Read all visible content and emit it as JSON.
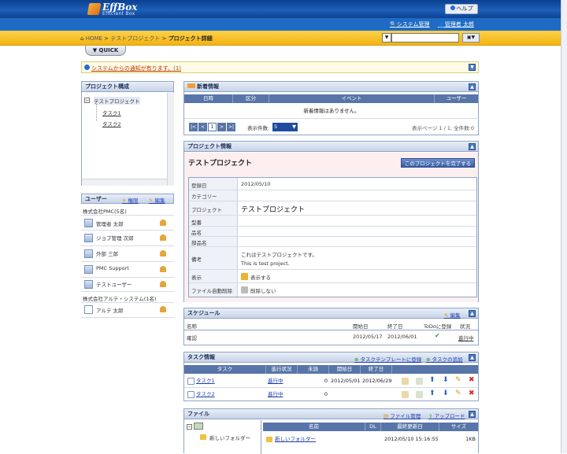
{
  "header": {
    "brand": "EffBox",
    "brand_sub": "Efficient Box",
    "help": "ヘルプ",
    "system_mgmt": "システム管理",
    "admin_user": "管理者 太郎"
  },
  "breadcrumb": {
    "home": "HOME",
    "sep": ">",
    "project": "テストプロジェクト",
    "current": "プロジェクト詳細"
  },
  "search": {
    "select_value": "▼",
    "button": "▣▼"
  },
  "quick": "▼ QUICK",
  "notice": "システムからの通知が有ります。(1)",
  "tree": {
    "title": "プロジェクト構成",
    "root": "テストプロジェクト",
    "children": [
      "タスク1",
      "タスク2"
    ]
  },
  "users": {
    "title": "ユーザー",
    "perm": "権限",
    "edit": "編集",
    "groups": [
      {
        "name": "株式会社PMC(5名)",
        "members": [
          "管理者 太郎",
          "ジョブ管理 次郎",
          "外部 三郎",
          "PMC Support",
          "テストユーザー"
        ]
      },
      {
        "name": "株式会社アルテ・システム(1名)",
        "members": [
          "アルテ 太郎"
        ]
      }
    ]
  },
  "news": {
    "title": "新着情報",
    "cols": [
      "日時",
      "区分",
      "イベント",
      "ユーザー"
    ],
    "empty": "新着情報はありません。",
    "pager": {
      "first": "|<",
      "prev": "<",
      "page": "1",
      "next": ">",
      "last": ">|",
      "count_label": "表示件数:",
      "count": "5",
      "summary": "表示ページ 1 / 1, 全件数:0"
    }
  },
  "project": {
    "title": "プロジェクト情報",
    "name": "テストプロジェクト",
    "complete_btn": "このプロジェクトを完了する",
    "fields": [
      {
        "label": "登録日",
        "value": "2012/05/10"
      },
      {
        "label": "カテゴリー",
        "value": ""
      },
      {
        "label": "プロジェクト",
        "value": "テストプロジェクト"
      },
      {
        "label": "型番",
        "value": ""
      },
      {
        "label": "品名",
        "value": ""
      },
      {
        "label": "部品名",
        "value": ""
      },
      {
        "label": "備考",
        "value": "これはテストプロジェクトです。",
        "value2": "This is test project."
      },
      {
        "label": "表示",
        "value": "表示する"
      },
      {
        "label": "ファイル自動削除",
        "value": "削除しない"
      }
    ]
  },
  "schedule": {
    "title": "スケジュール",
    "edit": "編集",
    "cols": [
      "名称",
      "開始日",
      "終了日",
      "ToDoに登録",
      "状況"
    ],
    "rows": [
      {
        "name": "確認",
        "start": "2012/05/17",
        "end": "2012/06/01",
        "todo": "✔",
        "status": "進行中"
      }
    ]
  },
  "tasks": {
    "title": "タスク情報",
    "tmpl": "タスクテンプレートに登録",
    "add": "タスクの追加",
    "cols": [
      "タスク",
      "進行状況",
      "未読",
      "開始日",
      "終了日"
    ],
    "rows": [
      {
        "name": "タスク1",
        "status": "進行中",
        "unread": "0",
        "start": "2012/05/01",
        "end": "2012/06/29"
      },
      {
        "name": "タスク2",
        "status": "進行中",
        "unread": "0",
        "start": "",
        "end": ""
      }
    ]
  },
  "files": {
    "title": "ファイル",
    "manage": "ファイル管理",
    "upload": "アップロード",
    "tree_item": "新しいフォルダー",
    "cols": [
      "名前",
      "DL",
      "最終更新日",
      "サイズ"
    ],
    "rows": [
      {
        "name": "新しいフォルダー",
        "dl": "",
        "date": "2012/05/10 15:16:55",
        "size": "1KB"
      }
    ]
  }
}
